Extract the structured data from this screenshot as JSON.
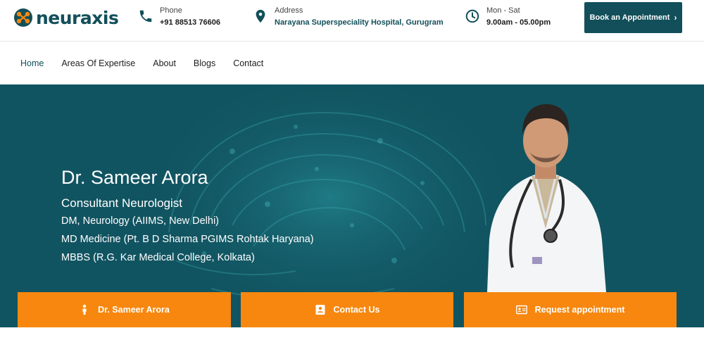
{
  "brand": {
    "name": "neuraxis",
    "color": "#124f5a",
    "logo_accent": "#f7870f"
  },
  "topbar": {
    "phone": {
      "icon": "phone-icon",
      "label": "Phone",
      "value": "+91 88513 76606"
    },
    "address": {
      "icon": "location-pin-icon",
      "label": "Address",
      "value": "Narayana Superspeciality Hospital, Gurugram"
    },
    "hours": {
      "icon": "clock-icon",
      "label": "Mon - Sat",
      "value": "9.00am - 05.00pm"
    },
    "book_button": "Book an Appointment"
  },
  "nav": {
    "items": [
      "Home",
      "Areas Of Expertise",
      "About",
      "Blogs",
      "Contact"
    ],
    "active": "Home"
  },
  "hero": {
    "name": "Dr. Sameer Arora",
    "title": "Consultant Neurologist",
    "qualifications": [
      "DM, Neurology (AIIMS, New Delhi)",
      "MD Medicine (Pt. B D Sharma PGIMS Rohtak Haryana)",
      "MBBS (R.G. Kar Medical College, Kolkata)"
    ],
    "background_color": "#115461"
  },
  "cta_buttons": [
    {
      "label": "Dr. Sameer Arora",
      "icon": "person-icon"
    },
    {
      "label": "Contact Us",
      "icon": "contact-card-icon"
    },
    {
      "label": "Request appointment",
      "icon": "id-card-icon"
    }
  ],
  "cta_color": "#f7870f"
}
